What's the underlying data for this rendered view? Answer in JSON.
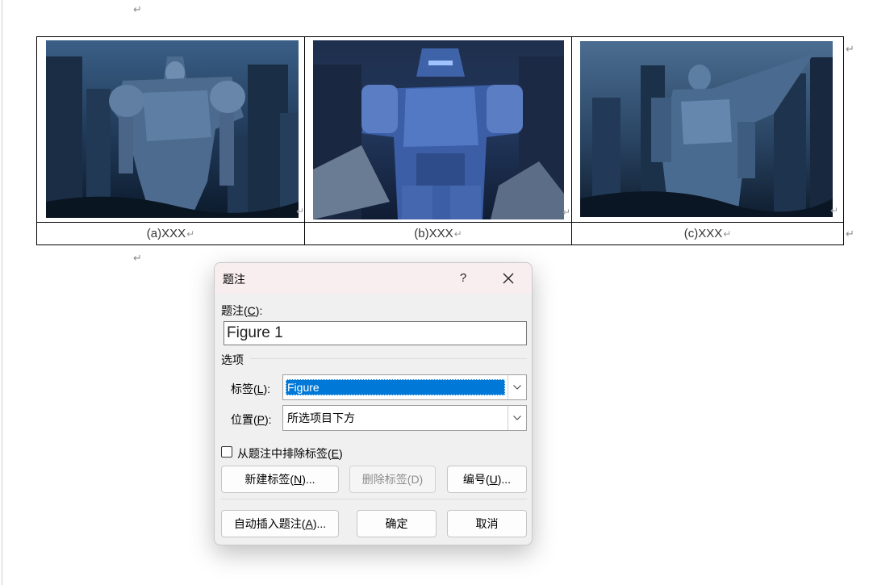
{
  "document": {
    "paragraph_mark": "↵",
    "figures": [
      {
        "caption": "(a)XXX"
      },
      {
        "caption": "(b)XXX"
      },
      {
        "caption": "(c)XXX"
      }
    ]
  },
  "dialog": {
    "title": "题注",
    "help": "?",
    "caption_label": "题注(",
    "caption_label_key": "C",
    "caption_label_end": "):",
    "caption_value": "Figure 1",
    "options_heading": "选项",
    "label_label": "标签(",
    "label_label_key": "L",
    "label_label_end": "):",
    "label_value": "Figure",
    "position_label": "位置(",
    "position_label_key": "P",
    "position_label_end": "):",
    "position_value": "所选项目下方",
    "exclude_label": "从题注中排除标签(",
    "exclude_label_key": "E",
    "exclude_label_end": ")",
    "exclude_checked": false,
    "buttons": {
      "new_label": "新建标签(",
      "new_label_key": "N",
      "new_label_end": ")...",
      "delete_label": "删除标签(D)",
      "numbering": "编号(",
      "numbering_key": "U",
      "numbering_end": ")...",
      "autocaption": "自动插入题注(",
      "autocaption_key": "A",
      "autocaption_end": ")...",
      "ok": "确定",
      "cancel": "取消"
    }
  },
  "colors": {
    "selection": "#0078d7",
    "titlebar": "#f8eef0",
    "dialog_bg": "#f0f0f0"
  }
}
